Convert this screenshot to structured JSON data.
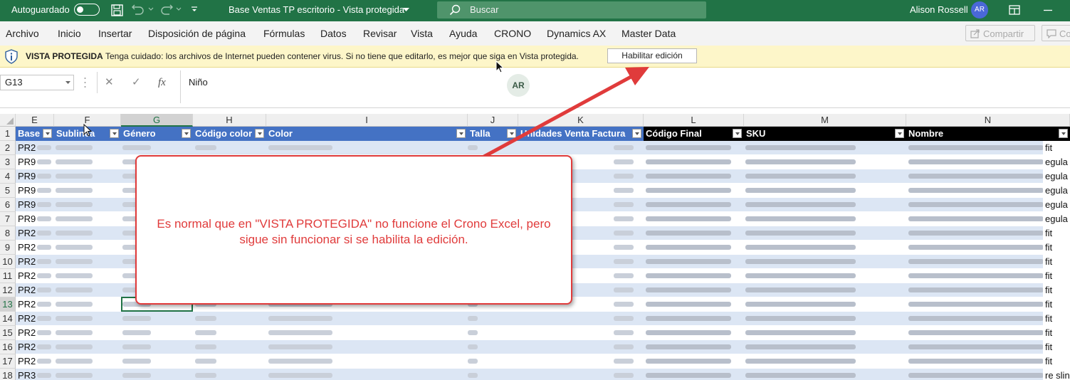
{
  "titlebar": {
    "autosave_label": "Autoguardado",
    "document_title": "Base Ventas TP escritorio  -  Vista protegida",
    "search_placeholder": "Buscar",
    "user_name": "Alison Rossell",
    "user_initials": "AR",
    "background_color": "#217346"
  },
  "menu": {
    "items": [
      "Archivo",
      "Inicio",
      "Insertar",
      "Disposición de página",
      "Fórmulas",
      "Datos",
      "Revisar",
      "Vista",
      "Ayuda",
      "CRONO",
      "Dynamics AX",
      "Master Data"
    ],
    "share_label": "Compartir",
    "comments_label": "Co"
  },
  "protected_view": {
    "title": "VISTA PROTEGIDA",
    "message": "Tenga cuidado: los archivos de Internet pueden contener virus. Si no tiene que editarlo, es mejor que siga en Vista protegida.",
    "enable_button": "Habilitar edición"
  },
  "formula_bar": {
    "name_box": "G13",
    "cancel_glyph": "✕",
    "enter_glyph": "✓",
    "fx_glyph": "fx",
    "value": "Niño",
    "presence_initials": "AR"
  },
  "grid": {
    "columns": [
      "E",
      "F",
      "G",
      "H",
      "I",
      "J",
      "K",
      "L",
      "M",
      "N"
    ],
    "selected_column": "G",
    "rows": [
      "1",
      "2",
      "3",
      "4",
      "5",
      "6",
      "7",
      "8",
      "9",
      "10",
      "11",
      "12",
      "13",
      "14",
      "15",
      "16",
      "17",
      "18"
    ],
    "selected_row": "13",
    "headers": [
      "Base",
      "Sublinea",
      "Género",
      "Código color",
      "Color",
      "Talla",
      "Unidades Venta Factura",
      "Código Final",
      "SKU",
      "Nombre"
    ],
    "col_e_values": [
      "PR2",
      "PR9",
      "PR9",
      "PR9",
      "PR9",
      "PR9",
      "PR2",
      "PR2",
      "PR2",
      "PR2",
      "PR2",
      "PR2",
      "PR2",
      "PR2",
      "PR2",
      "PR2",
      "PR3"
    ],
    "col_n_suffix": [
      "fit",
      "egula",
      "egula",
      "egula",
      "egula",
      "egula",
      "fit",
      "fit",
      "fit",
      "fit",
      "fit",
      "fit",
      "fit",
      "fit",
      "fit",
      "fit",
      "re slin"
    ],
    "header_colors": {
      "blue": "#4472c4",
      "black": "#000000"
    },
    "band_color": "#dce6f4"
  },
  "callout": {
    "text": "Es normal que en \"VISTA PROTEGIDA\" no funcione el Crono Excel, pero sigue sin funcionar si se habilita la edición.",
    "color": "#e03b3b"
  }
}
